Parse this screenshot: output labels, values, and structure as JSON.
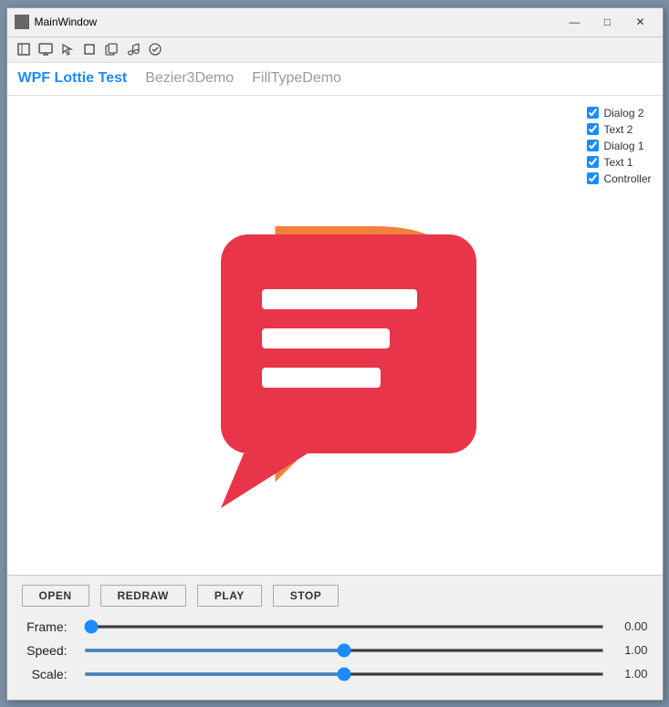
{
  "window": {
    "title": "MainWindow",
    "icon": "window-icon"
  },
  "titlebar": {
    "controls": {
      "minimize": "—",
      "maximize": "□",
      "close": "✕"
    }
  },
  "toolbar": {
    "icons": [
      "cursor-icon",
      "monitor-icon",
      "pointer-icon",
      "square-icon",
      "copy-icon",
      "music-icon",
      "check-circle-icon"
    ]
  },
  "menubar": {
    "items": [
      {
        "label": "WPF Lottie Test",
        "active": true
      },
      {
        "label": "Bezier3Demo",
        "active": false
      },
      {
        "label": "FillTypeDemo",
        "active": false
      }
    ]
  },
  "checkboxes": {
    "items": [
      {
        "label": "Dialog 2",
        "checked": true
      },
      {
        "label": "Text 2",
        "checked": true
      },
      {
        "label": "Dialog 1",
        "checked": true
      },
      {
        "label": "Text 1",
        "checked": true
      },
      {
        "label": "Controller",
        "checked": true
      }
    ]
  },
  "buttons": {
    "open": "OPEN",
    "redraw": "REDRAW",
    "play": "PLAY",
    "stop": "STOP"
  },
  "sliders": {
    "frame": {
      "label": "Frame:",
      "value": 0.0,
      "display": "0.00",
      "min": 0,
      "max": 100,
      "pos": 0
    },
    "speed": {
      "label": "Speed:",
      "value": 1.0,
      "display": "1.00",
      "min": 0,
      "max": 2,
      "pos": 50
    },
    "scale": {
      "label": "Scale:",
      "value": 1.0,
      "display": "1.00",
      "min": 0,
      "max": 2,
      "pos": 50
    }
  },
  "illustration": {
    "bubble1_color": "#e8354a",
    "bubble2_color": "#f0813a"
  }
}
